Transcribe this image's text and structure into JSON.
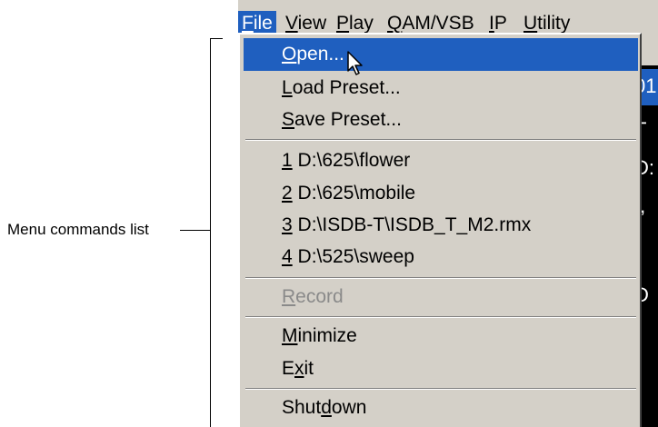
{
  "menubar": {
    "items": [
      {
        "label": "File",
        "mnemonic": "F",
        "rest": "ile"
      },
      {
        "label": "View",
        "mnemonic": "V",
        "rest": "iew"
      },
      {
        "label": "Play",
        "mnemonic": "P",
        "rest": "lay"
      },
      {
        "label": "QAM/VSB",
        "mnemonic": "Q",
        "rest": "AM/VSB"
      },
      {
        "label": "IP",
        "mnemonic": "I",
        "rest": "P"
      },
      {
        "label": "Utility",
        "mnemonic": "U",
        "rest": "tility"
      }
    ]
  },
  "file_menu": {
    "open": {
      "mn": "O",
      "rest": "pen..."
    },
    "load_preset": {
      "mn": "L",
      "rest": "oad Preset..."
    },
    "save_preset": {
      "mn": "S",
      "rest": "ave Preset..."
    },
    "recent": [
      {
        "mn": "1",
        "rest": " D:\\625\\flower"
      },
      {
        "mn": "2",
        "rest": " D:\\625\\mobile"
      },
      {
        "mn": "3",
        "rest": " D:\\ISDB-T\\ISDB_T_M2.rmx"
      },
      {
        "mn": "4",
        "rest": " D:\\525\\sweep"
      }
    ],
    "record": {
      "mn": "R",
      "rest": "ecord"
    },
    "minimize": {
      "mn": "M",
      "rest": "inimize"
    },
    "exit": {
      "pre": "E",
      "mn": "x",
      "rest": "it"
    },
    "shutdown": {
      "pre": "Shut",
      "mn": "d",
      "rest": "own"
    }
  },
  "background_glyphs": [
    "01",
    "T",
    "D:",
    "I,",
    "D"
  ],
  "callout": {
    "label": "Menu commands list"
  },
  "colors": {
    "menu_bg": "#d4d0c8",
    "highlight": "#1f5fbf",
    "disabled": "#8a8a8a"
  },
  "icons": {
    "cursor": "arrow-pointer-icon"
  }
}
